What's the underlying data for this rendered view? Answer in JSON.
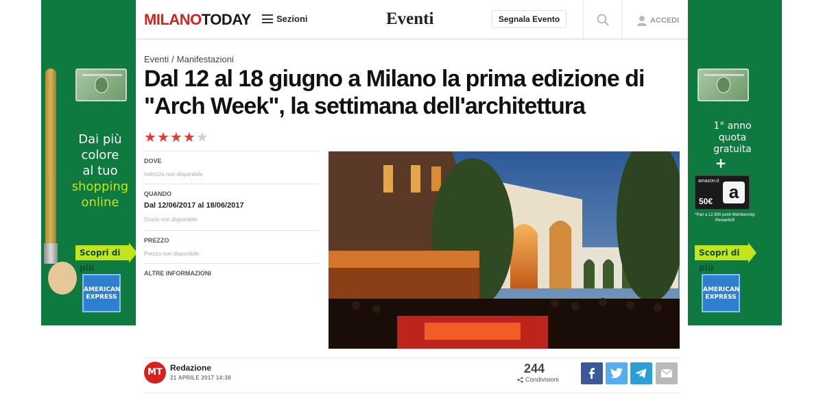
{
  "header": {
    "logo_part1": "MILANO",
    "logo_part2": "TODAY",
    "sections_label": "Sezioni",
    "section_title": "Eventi",
    "report_event_button": "Segnala Evento",
    "login_label": "ACCEDI"
  },
  "breadcrumb": {
    "category": "Eventi",
    "separator": "/",
    "subcategory": "Manifestazioni"
  },
  "article": {
    "title": "Dal 12 al 18 giugno a Milano la prima edizione di \"Arch Week\", la settimana dell'architettura",
    "rating": {
      "value": 4,
      "max": 5
    }
  },
  "event_info": {
    "where_label": "DOVE",
    "where_value": "Indirizzo non disponibile",
    "when_label": "QUANDO",
    "when_value": "Dal 12/06/2017 al 18/06/2017",
    "time_value": "Orario non disponibile",
    "price_label": "PREZZO",
    "price_value": "Prezzo non disponibile",
    "more_label": "ALTRE INFORMAZIONI"
  },
  "author": {
    "initials": "MT",
    "name": "Redazione",
    "date": "21 APRILE 2017 14:38"
  },
  "share": {
    "count": "244",
    "label": "Condivisioni"
  },
  "ads": {
    "left_line1": "Dai più",
    "left_line2": "colore",
    "left_line3": "al tuo",
    "left_line4": "shopping",
    "left_line5": "online",
    "cta": "Scopri di più",
    "amex_line1": "AMERICAN",
    "amex_line2": "EXPRESS",
    "right_line1": "1° anno",
    "right_line2": "quota",
    "right_line3": "gratuita",
    "right_plus": "+",
    "amazon_brand": "amazon.it",
    "amazon_value": "50€",
    "amazon_logo": "a",
    "amazon_note": "*Pari a 12.900 punti Membership Rewards®"
  },
  "colors": {
    "brand_red": "#d7211c",
    "ad_green": "#0e7a3f",
    "ad_lime": "#c4e51d",
    "star_on": "#e8382e",
    "facebook": "#3b5998",
    "twitter": "#55acee",
    "telegram": "#2c9ed8",
    "email": "#b9b9b9"
  }
}
